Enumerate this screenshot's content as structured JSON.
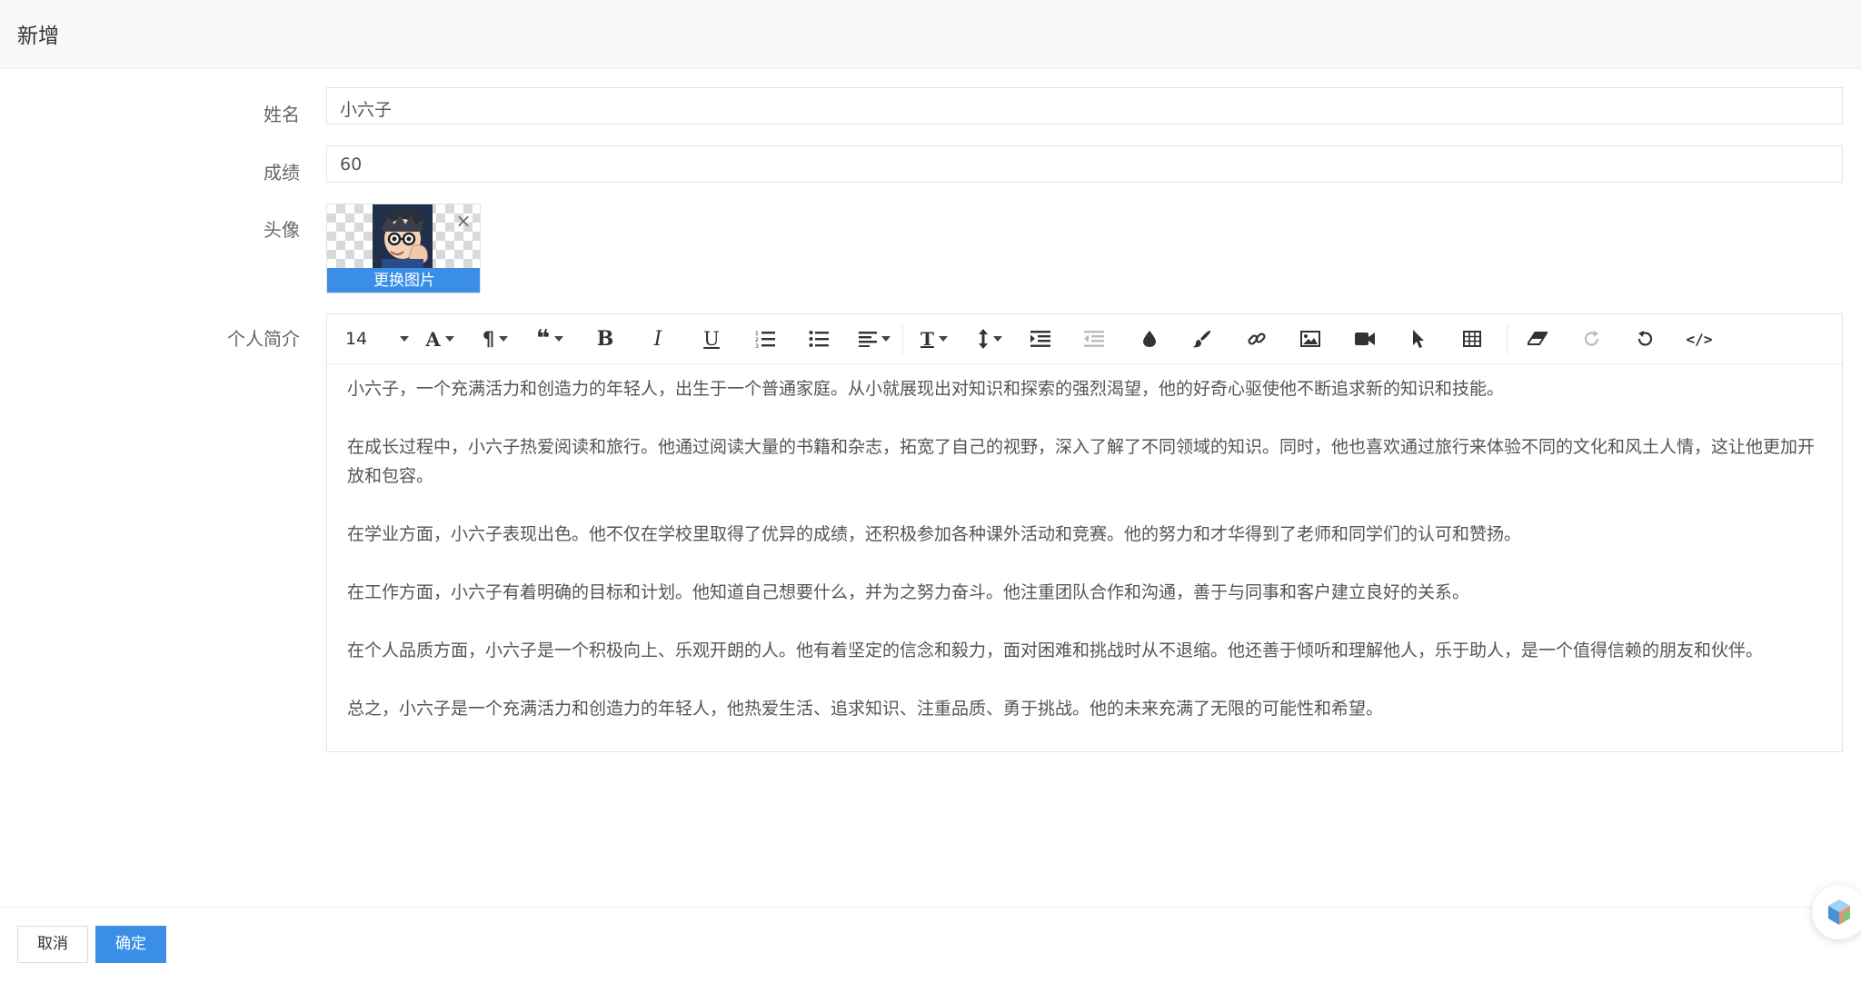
{
  "header": {
    "title": "新增"
  },
  "form": {
    "name": {
      "label": "姓名",
      "value": "小六子"
    },
    "score": {
      "label": "成绩",
      "value": "60"
    },
    "avatar": {
      "label": "头像",
      "change_label": "更换图片"
    },
    "bio": {
      "label": "个人简介",
      "paragraphs": [
        "小六子，一个充满活力和创造力的年轻人，出生于一个普通家庭。从小就展现出对知识和探索的强烈渴望，他的好奇心驱使他不断追求新的知识和技能。",
        "",
        "在成长过程中，小六子热爱阅读和旅行。他通过阅读大量的书籍和杂志，拓宽了自己的视野，深入了解了不同领域的知识。同时，他也喜欢通过旅行来体验不同的文化和风土人情，这让他更加开放和包容。",
        "",
        "在学业方面，小六子表现出色。他不仅在学校里取得了优异的成绩，还积极参加各种课外活动和竞赛。他的努力和才华得到了老师和同学们的认可和赞扬。",
        "",
        "在工作方面，小六子有着明确的目标和计划。他知道自己想要什么，并为之努力奋斗。他注重团队合作和沟通，善于与同事和客户建立良好的关系。",
        "",
        "在个人品质方面，小六子是一个积极向上、乐观开朗的人。他有着坚定的信念和毅力，面对困难和挑战时从不退缩。他还善于倾听和理解他人，乐于助人，是一个值得信赖的朋友和伙伴。",
        "",
        "总之，小六子是一个充满活力和创造力的年轻人，他热爱生活、追求知识、注重品质、勇于挑战。他的未来充满了无限的可能性和希望。"
      ]
    }
  },
  "toolbar": {
    "font_size": "14",
    "icons": [
      "font-size-icon",
      "font-color-text-icon",
      "paragraph-icon",
      "quote-icon",
      "bold-icon",
      "italic-icon",
      "underline-icon",
      "ordered-list-icon",
      "unordered-list-icon",
      "align-icon",
      "font-family-icon",
      "line-height-icon",
      "indent-icon",
      "outdent-icon",
      "text-color-icon",
      "background-color-icon",
      "link-icon",
      "image-icon",
      "video-icon",
      "cursor-icon",
      "table-icon",
      "clear-format-icon",
      "redo-icon",
      "undo-icon",
      "code-view-icon"
    ]
  },
  "footer": {
    "cancel_label": "取消",
    "ok_label": "确定"
  },
  "colors": {
    "primary": "#3a8ee6",
    "border": "#e2e2e2",
    "header_bg": "#f8f8f8"
  }
}
